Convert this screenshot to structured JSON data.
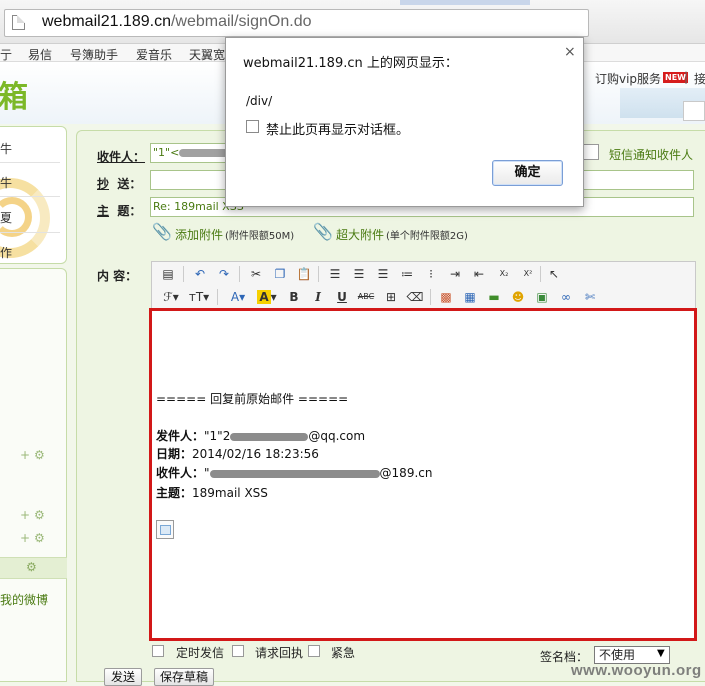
{
  "browser": {
    "url_host": "webmail21.189.cn",
    "url_path": "/webmail/signOn.do"
  },
  "nav": {
    "items": [
      "亍",
      "易信",
      "号簿助手",
      "爱音乐",
      "天翼宽"
    ]
  },
  "banner": {
    "logo_char": "箱",
    "vip_link": "订购vip服务",
    "new_badge": "NEW",
    "separator": "|",
    "more": "接"
  },
  "sidebar": {
    "chars": [
      "牛",
      "牛",
      "夏",
      "作"
    ],
    "weibo_link": "我的微博"
  },
  "compose": {
    "to_label": "收件人：",
    "to_value": "\"1\"<",
    "sms_notify": "短信通知收件人",
    "cc_label_u": "抄",
    "cc_label_rest": "送：",
    "subject_label_u": "主",
    "subject_label_rest": "题：",
    "subject_value": "Re: 189mail XSS",
    "attach_link": "添加附件",
    "attach_limit": "(附件限额50M)",
    "big_attach_link": "超大附件",
    "big_attach_limit": "(单个附件限额2G)",
    "content_label": "内 容："
  },
  "editor": {
    "quote_header": "===== 回复前原始邮件 =====",
    "from_label": "发件人：",
    "from_value_pre": "\"1\"2",
    "from_value_post": "@qq.com",
    "date_label": "日期：",
    "date_value": "2014/02/16 18:23:56",
    "to_label": "收件人：",
    "to_value_pre": "\"",
    "to_value_post": "@189.cn",
    "subject_label": "主题：",
    "subject_value": "189mail XSS"
  },
  "options": {
    "scheduled": "定时发信",
    "receipt": "请求回执",
    "urgent": "紧急",
    "signature_label": "签名档：",
    "signature_value": "不使用",
    "send_button": "发送",
    "save_draft_button": "保存草稿"
  },
  "dialog": {
    "title": "webmail21.189.cn 上的网页显示：",
    "close": "×",
    "message": "/div/",
    "checkbox_label": "禁止此页再显示对话框。",
    "ok_button": "确定"
  },
  "watermark": "www.wooyun.org",
  "colors": {
    "accent_green": "#4a7b12",
    "highlight_border": "#d21818",
    "panel_bg": "#eef5e3"
  }
}
